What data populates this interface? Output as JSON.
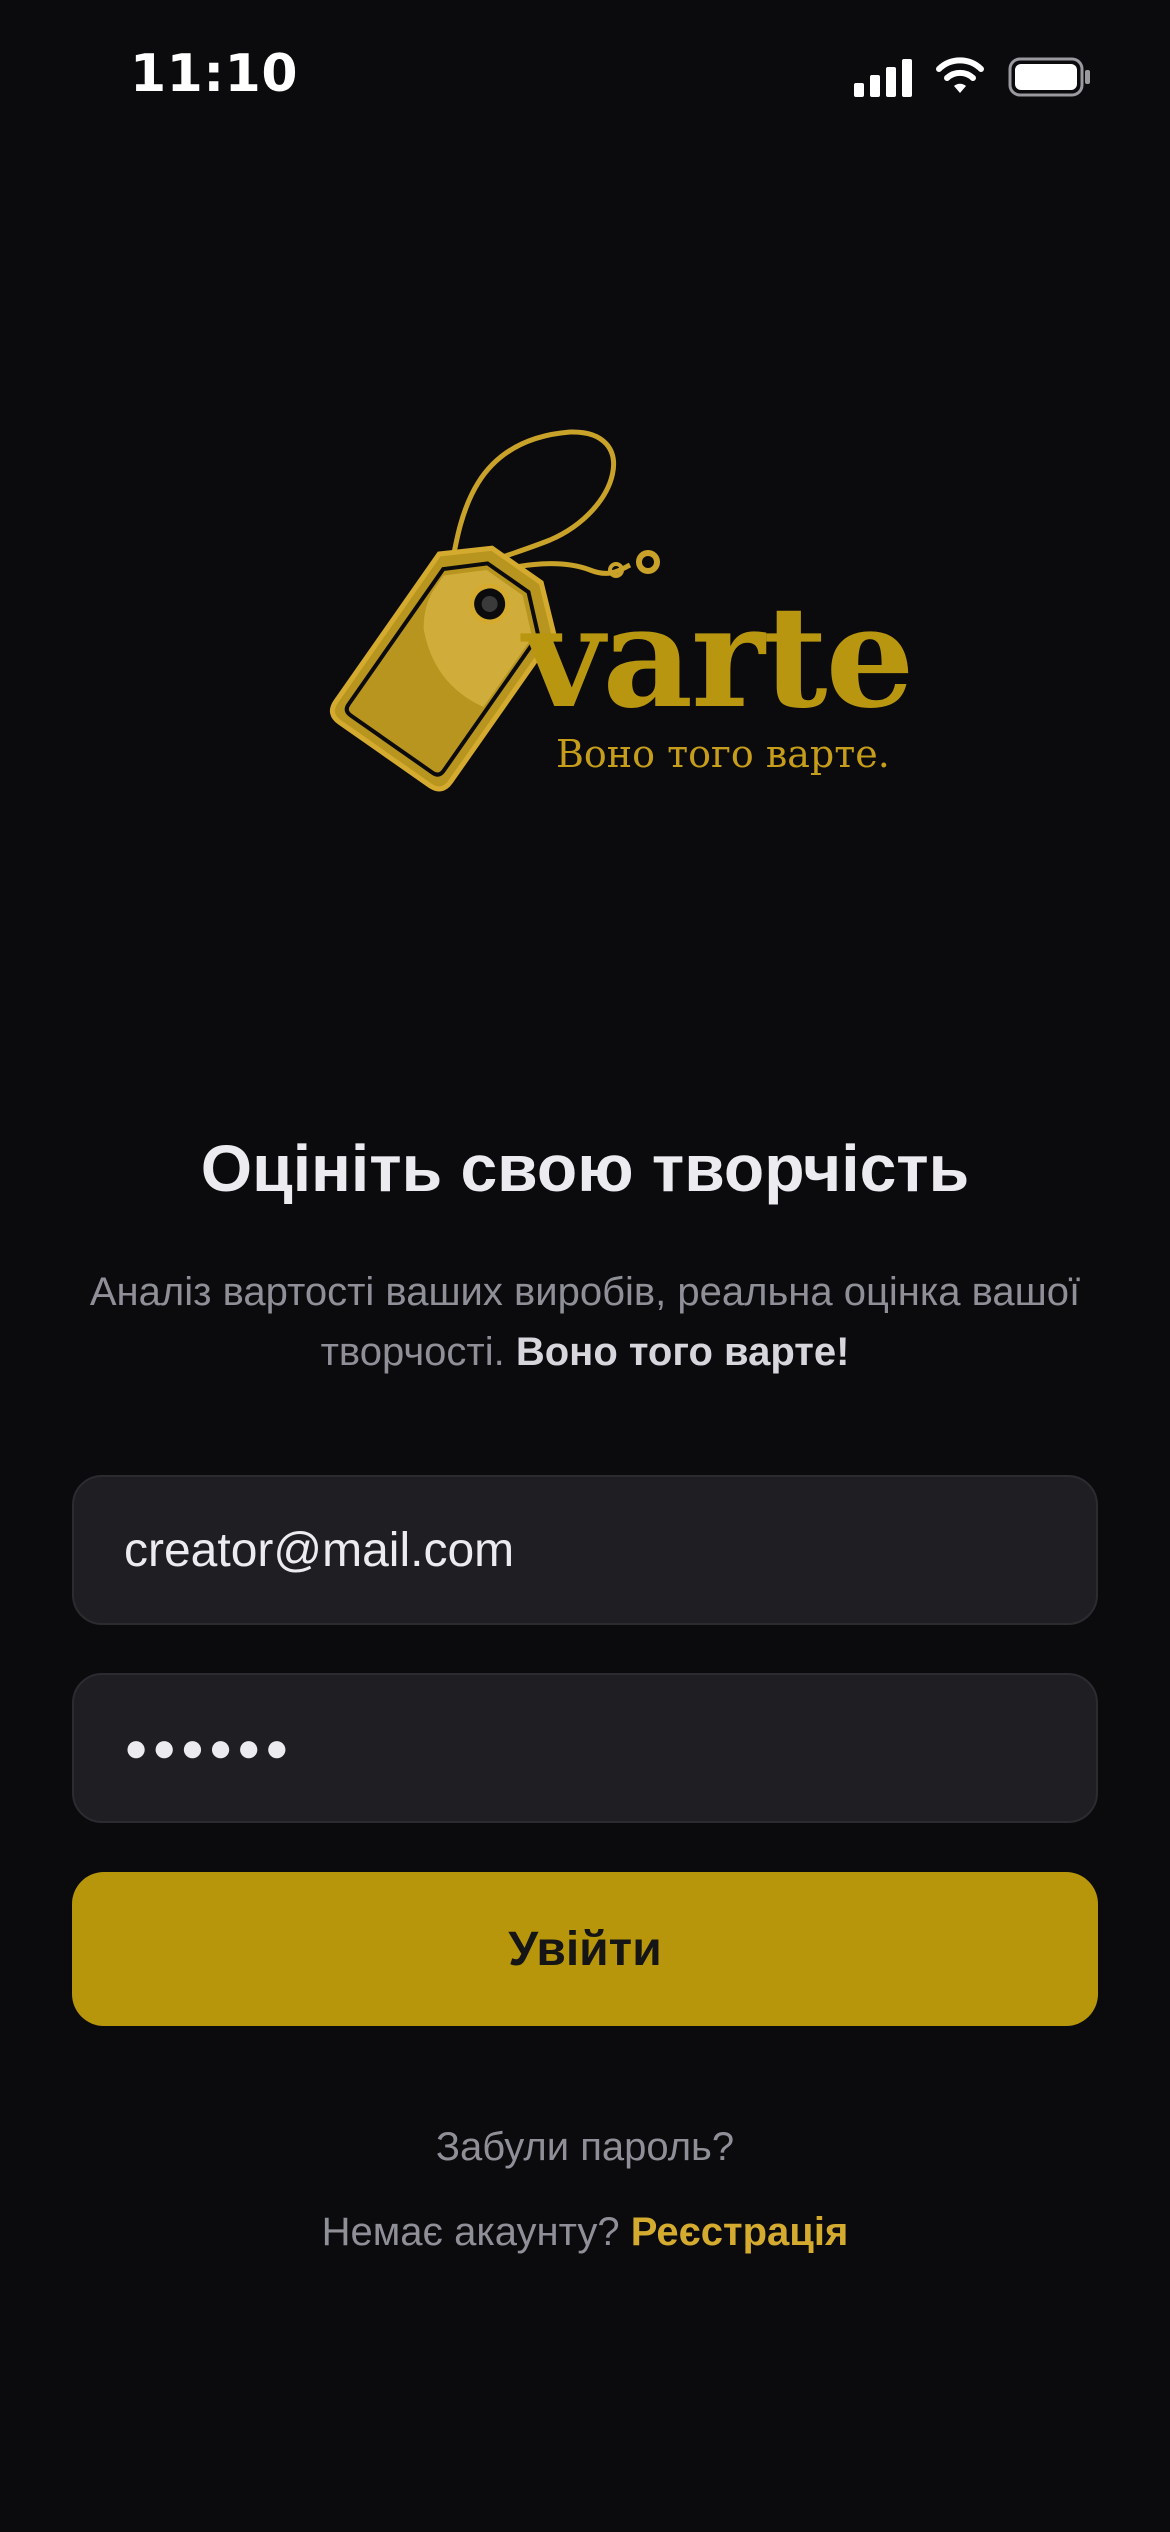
{
  "status_bar": {
    "time": "11:10",
    "icons": [
      "cellular-signal-icon",
      "wifi-icon",
      "battery-icon"
    ]
  },
  "logo": {
    "wordmark": "varte",
    "tagline": "Воно того варте.",
    "icon": "price-tag-icon"
  },
  "intro": {
    "title": "Оцініть свою творчість",
    "subtitle_text": "Аналіз вартості ваших виробів, реальна оцінка вашої творчості.",
    "subtitle_emphasis": "Воно того варте!"
  },
  "form": {
    "email_value": "creator@mail.com",
    "password_value": "●●●●●●",
    "login_label": "Увійти",
    "forgot_password": "Забули пароль?",
    "no_account_text": "Немає акаунту?",
    "register_label": "Реєстрація"
  },
  "colors": {
    "background": "#0b0b0e",
    "accent": "#b8960b",
    "field_background": "#1f1f23",
    "muted_text": "#8f8f98",
    "link": "#d4ab2f"
  }
}
